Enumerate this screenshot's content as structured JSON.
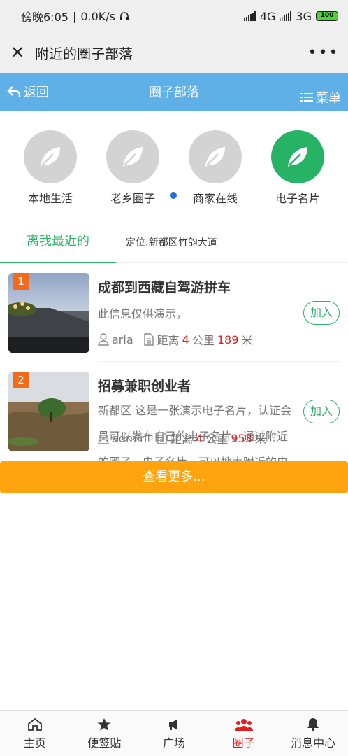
{
  "status": {
    "time": "傍晚6:05",
    "speed": "0.0K/s",
    "net1": "4G",
    "net2": "3G",
    "battery": "100"
  },
  "titlebar": {
    "title": "附近的圈子部落",
    "more": "•••"
  },
  "header": {
    "back": "返回",
    "title": "圈子部落",
    "menu": "菜单"
  },
  "categories": [
    {
      "label": "本地生活",
      "icon": "leaf-icon"
    },
    {
      "label": "老乡圈子",
      "icon": "leaf-icon"
    },
    {
      "label": "商家在线",
      "icon": "leaf-icon"
    },
    {
      "label": "电子名片",
      "icon": "leaf-icon"
    }
  ],
  "tabs": {
    "active": "离我最近的",
    "location": "定位:新都区竹韵大道"
  },
  "items": [
    {
      "rank": "1",
      "title": "成都到西藏自驾游拼车",
      "desc": "此信息仅供演示，",
      "user": "aria",
      "dist_prefix": "距离",
      "km": "4",
      "km_unit": "公里",
      "m": "189",
      "m_unit": "米",
      "join": "加入"
    },
    {
      "rank": "2",
      "title": "招募兼职创业者",
      "desc": "新都区 这是一张演示电子名片，认证会员可以发布自己的电子名片。通过附近的圈子－电子名片，可以搜索附近的电子名片名片演示",
      "user": "admin",
      "dist_prefix": "距离",
      "km": "4",
      "km_unit": "公里",
      "m": "953",
      "m_unit": "米",
      "join": "加入"
    }
  ],
  "more_button": "查看更多...",
  "bottom_nav": [
    {
      "label": "主页",
      "icon": "home-icon"
    },
    {
      "label": "便签贴",
      "icon": "star-icon"
    },
    {
      "label": "广场",
      "icon": "megaphone-icon"
    },
    {
      "label": "圈子",
      "icon": "group-icon"
    },
    {
      "label": "消息中心",
      "icon": "bell-icon"
    }
  ],
  "colors": {
    "accent": "#27b366",
    "header": "#5fb0e6",
    "more": "#ffa30f",
    "active_nav": "#e02020"
  }
}
